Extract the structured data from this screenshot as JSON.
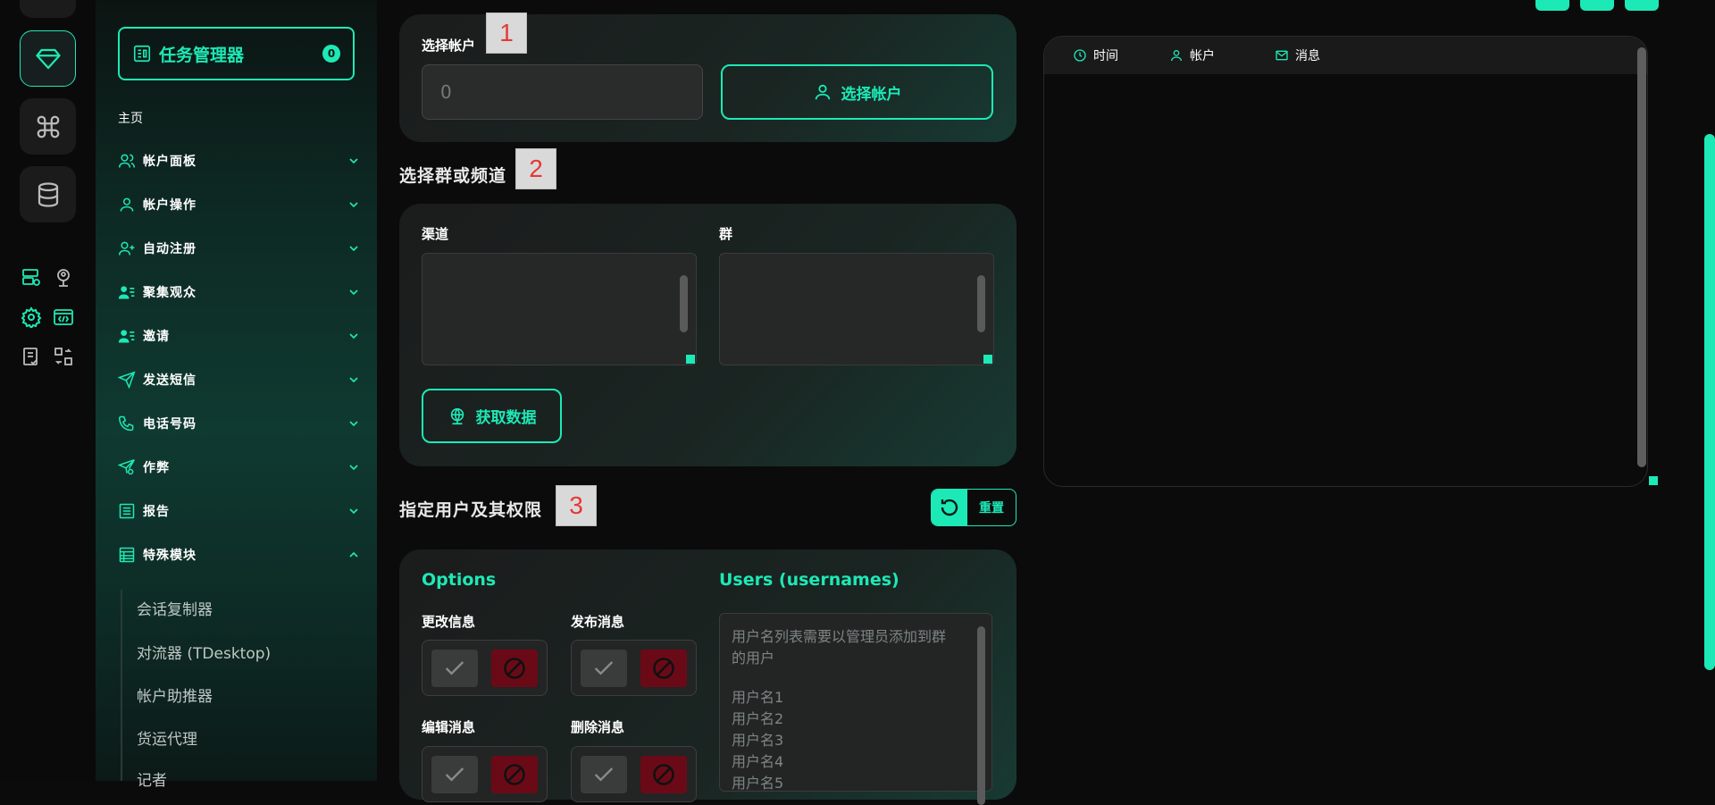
{
  "sidebar": {
    "task_manager": {
      "label": "任务管理器",
      "count": "0"
    },
    "home": "主页",
    "menu": [
      {
        "label": "帐户面板"
      },
      {
        "label": "帐户操作"
      },
      {
        "label": "自动注册"
      },
      {
        "label": "聚集观众"
      },
      {
        "label": "邀请"
      },
      {
        "label": "发送短信"
      },
      {
        "label": "电话号码"
      },
      {
        "label": "作弊"
      },
      {
        "label": "报告"
      },
      {
        "label": "特殊模块"
      }
    ],
    "submenu": [
      "会话复制器",
      "对流器 (TDesktop)",
      "帐户助推器",
      "货运代理",
      "记者"
    ]
  },
  "step1": {
    "marker": "1",
    "label": "选择帐户",
    "input_value": "0",
    "button": "选择帐户"
  },
  "step2": {
    "marker": "2",
    "title": "选择群或频道",
    "channels_label": "渠道",
    "groups_label": "群",
    "fetch_button": "获取数据"
  },
  "step3": {
    "marker": "3",
    "title": "指定用户及其权限",
    "reset_button": "重置",
    "options_title": "Options",
    "users_title": "Users (usernames)",
    "options": [
      "更改信息",
      "发布消息",
      "编辑消息",
      "删除消息"
    ],
    "users_placeholder_lines": [
      "用户名列表需要以管理员添加到群",
      "的用户",
      "",
      "用户名1",
      "用户名2",
      "用户名3",
      "用户名4",
      "用户名5"
    ]
  },
  "log": {
    "columns": [
      "时间",
      "帐户",
      "消息"
    ]
  },
  "colors": {
    "accent": "#1de9b6",
    "deny": "#6b0a17",
    "marker_text": "#e53935"
  }
}
